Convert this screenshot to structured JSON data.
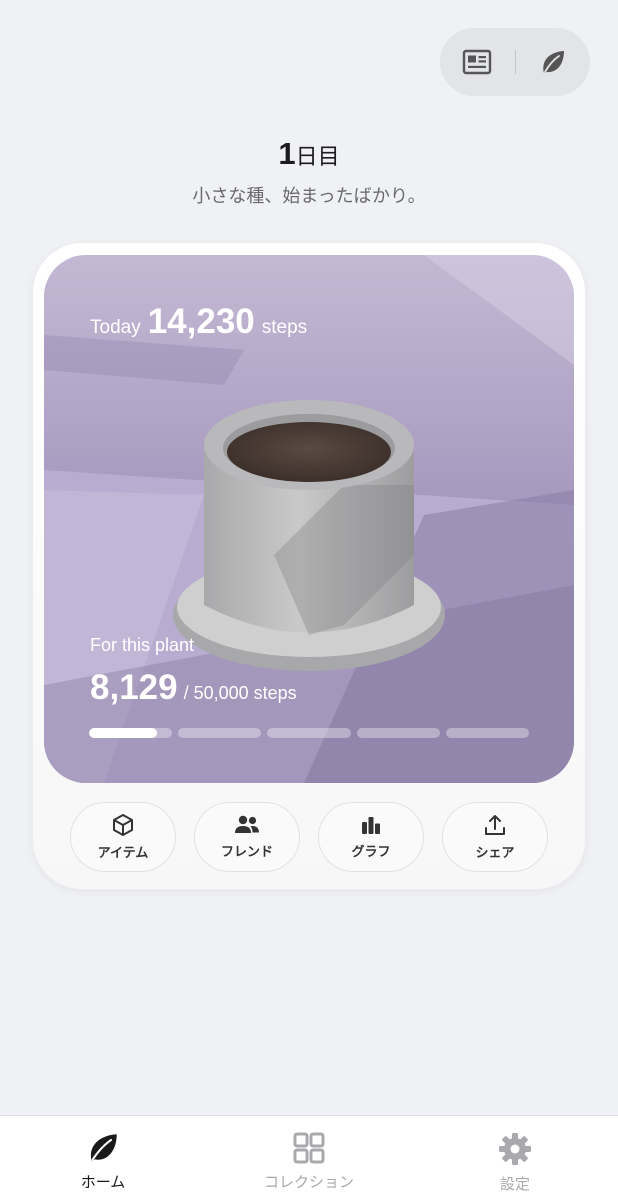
{
  "header": {
    "day_number": "1",
    "day_suffix": "日目",
    "subtitle": "小さな種、始まったばかり。"
  },
  "top_actions": [
    {
      "icon": "news-icon"
    },
    {
      "icon": "leaf-icon"
    }
  ],
  "card": {
    "today_label": "Today",
    "today_steps": "14,230",
    "today_unit": "steps",
    "plant_label": "For this plant",
    "plant_steps": "8,129",
    "plant_goal": "/ 50,000 steps",
    "progress_fraction": 0.1626,
    "progress_segments": 5
  },
  "actions": [
    {
      "label": "アイテム",
      "icon": "cube-icon"
    },
    {
      "label": "フレンド",
      "icon": "people-icon"
    },
    {
      "label": "グラフ",
      "icon": "bar-chart-icon"
    },
    {
      "label": "シェア",
      "icon": "share-icon"
    }
  ],
  "bottom_nav": [
    {
      "label": "ホーム",
      "icon": "leaf-icon",
      "active": true
    },
    {
      "label": "コレクション",
      "icon": "grid-icon",
      "active": false
    },
    {
      "label": "設定",
      "icon": "gear-icon",
      "active": false
    }
  ],
  "colors": {
    "background": "#f0f1f5",
    "photo_bg": "#b3a6c8",
    "active_nav": "#1a1a1a",
    "inactive_nav": "#a9a9ad"
  }
}
